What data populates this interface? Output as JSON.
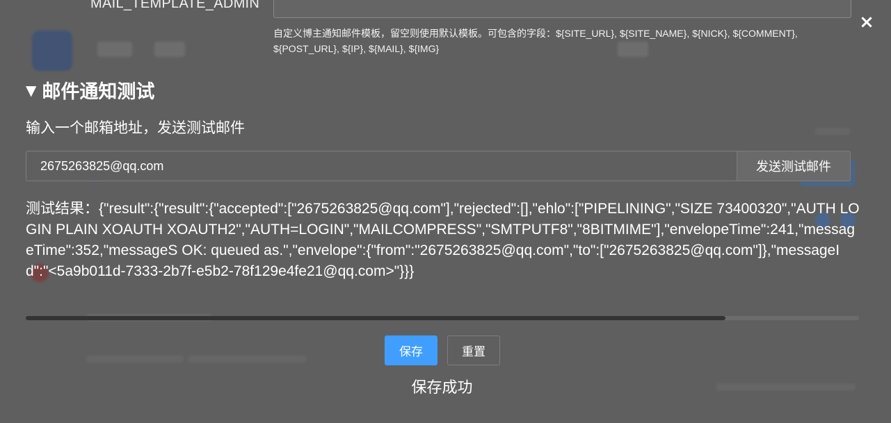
{
  "template": {
    "label": "MAIL_TEMPLATE_ADMIN",
    "value": "",
    "help": "自定义博主通知邮件模板，留空则使用默认模板。可包含的字段：${SITE_URL}, ${SITE_NAME}, ${NICK}, ${COMMENT}, ${POST_URL}, ${IP}, ${MAIL}, ${IMG}"
  },
  "close_label": "×",
  "section": {
    "caret": "▼",
    "title": "邮件通知测试"
  },
  "test": {
    "instruction": "输入一个邮箱地址，发送测试邮件",
    "email_value": "2675263825@qq.com",
    "send_label": "发送测试邮件",
    "result_text": "测试结果：{\"result\":{\"result\":{\"accepted\":[\"2675263825@qq.com\"],\"rejected\":[],\"ehlo\":[\"PIPELINING\",\"SIZE 73400320\",\"AUTH LOGIN PLAIN XOAUTH XOAUTH2\",\"AUTH=LOGIN\",\"MAILCOMPRESS\",\"SMTPUTF8\",\"8BITMIME\"],\"envelopeTime\":241,\"messageTime\":352,\"messageS OK: queued as.\",\"envelope\":{\"from\":\"2675263825@qq.com\",\"to\":[\"2675263825@qq.com\"]},\"messageId\":\"<5a9b011d-7333-2b7f-e5b2-78f129e4fe21@qq.com>\"}}}"
  },
  "scroll": {
    "position_fraction": 0.84
  },
  "actions": {
    "save_label": "保存",
    "reset_label": "重置"
  },
  "status": {
    "message": "保存成功"
  },
  "colors": {
    "accent": "#409eff",
    "overlay": "#5f5f5f"
  }
}
